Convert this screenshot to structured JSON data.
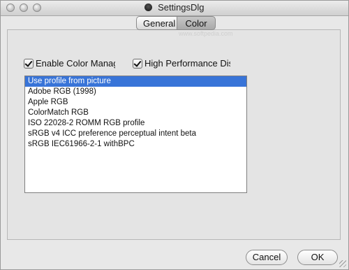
{
  "window": {
    "title": "SettingsDlg"
  },
  "tabs": [
    {
      "label": "General",
      "selected": false
    },
    {
      "label": "Color",
      "selected": true
    }
  ],
  "watermark": "www.softpedia.com",
  "checkboxes": [
    {
      "label": "Enable Color Manage",
      "checked": true
    },
    {
      "label": "High Performance Disp",
      "checked": true
    }
  ],
  "profiles": {
    "selected_index": 0,
    "items": [
      "Use profile from picture",
      "Adobe RGB (1998)",
      "Apple RGB",
      "ColorMatch RGB",
      "ISO 22028-2 ROMM RGB profile",
      "sRGB v4 ICC preference perceptual intent beta",
      "sRGB IEC61966-2-1 withBPC"
    ]
  },
  "buttons": {
    "cancel": "Cancel",
    "ok": "OK"
  },
  "colors": {
    "selection": "#3874d8"
  }
}
